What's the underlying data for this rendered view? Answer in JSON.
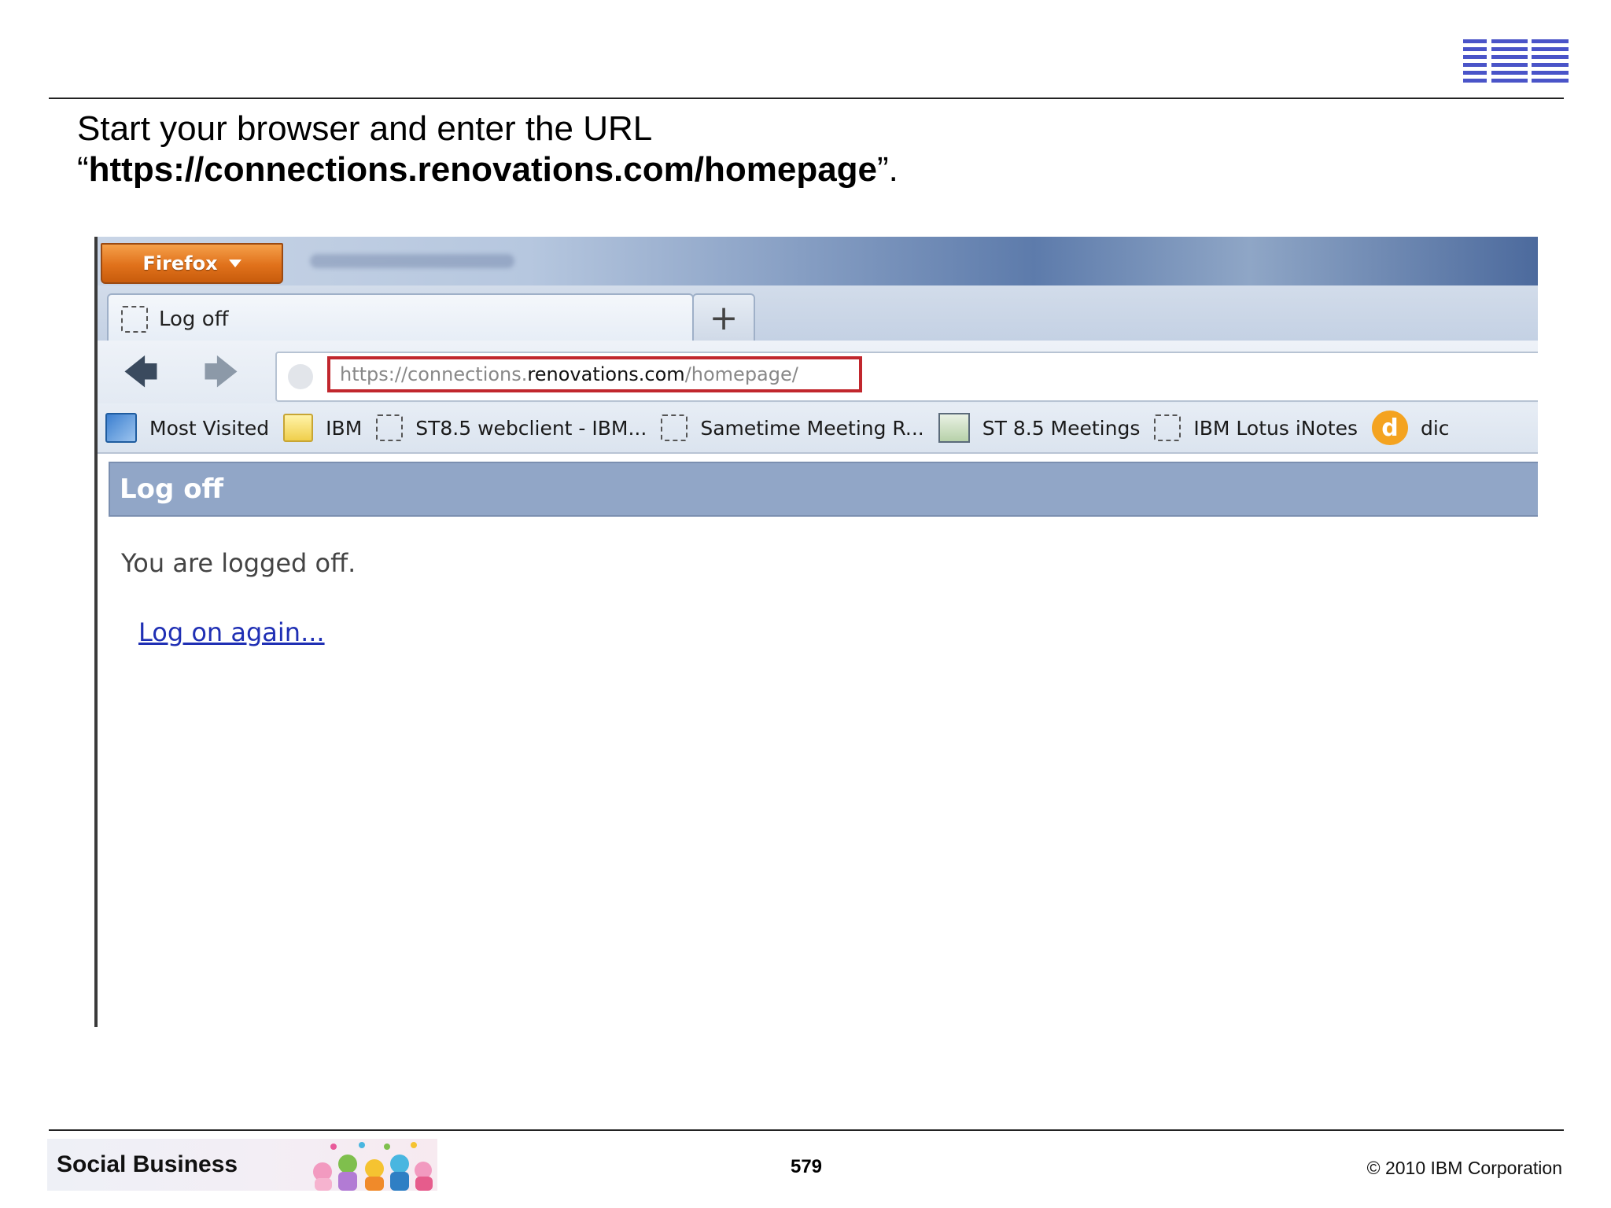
{
  "slide": {
    "instruction_line1": "Start your browser and enter the URL",
    "instruction_quote_open": "“",
    "instruction_url": "https://connections.renovations.com/homepage",
    "instruction_quote_close": "”."
  },
  "browser": {
    "menu_button_label": "Firefox",
    "tab_title": "Log off",
    "new_tab_label": "+",
    "url": {
      "prefix": "https://connections.",
      "domain": "renovations.com",
      "suffix": "/homepage/"
    },
    "bookmarks": [
      {
        "label": "Most Visited",
        "icon": "most-visited-icon"
      },
      {
        "label": "IBM",
        "icon": "folder-icon"
      },
      {
        "label": "ST8.5 webclient - IBM...",
        "icon": "blank-page-icon"
      },
      {
        "label": "Sametime Meeting R...",
        "icon": "blank-page-icon"
      },
      {
        "label": "ST 8.5 Meetings",
        "icon": "presentation-icon"
      },
      {
        "label": "IBM Lotus iNotes",
        "icon": "blank-page-icon"
      },
      {
        "label": "dic",
        "icon": "dictionary-icon"
      }
    ]
  },
  "page": {
    "header": "Log off",
    "status_message": "You are logged off.",
    "relogin_link": "Log on again..."
  },
  "footer": {
    "brand": "Social Business",
    "page_number": "579",
    "copyright": "© 2010 IBM Corporation"
  },
  "colors": {
    "ibm_blue": "#4a54c8",
    "url_highlight": "#c1272d",
    "page_header_bg": "#91a6c7",
    "firefox_orange": "#e0711b",
    "link": "#1f2fb4"
  }
}
